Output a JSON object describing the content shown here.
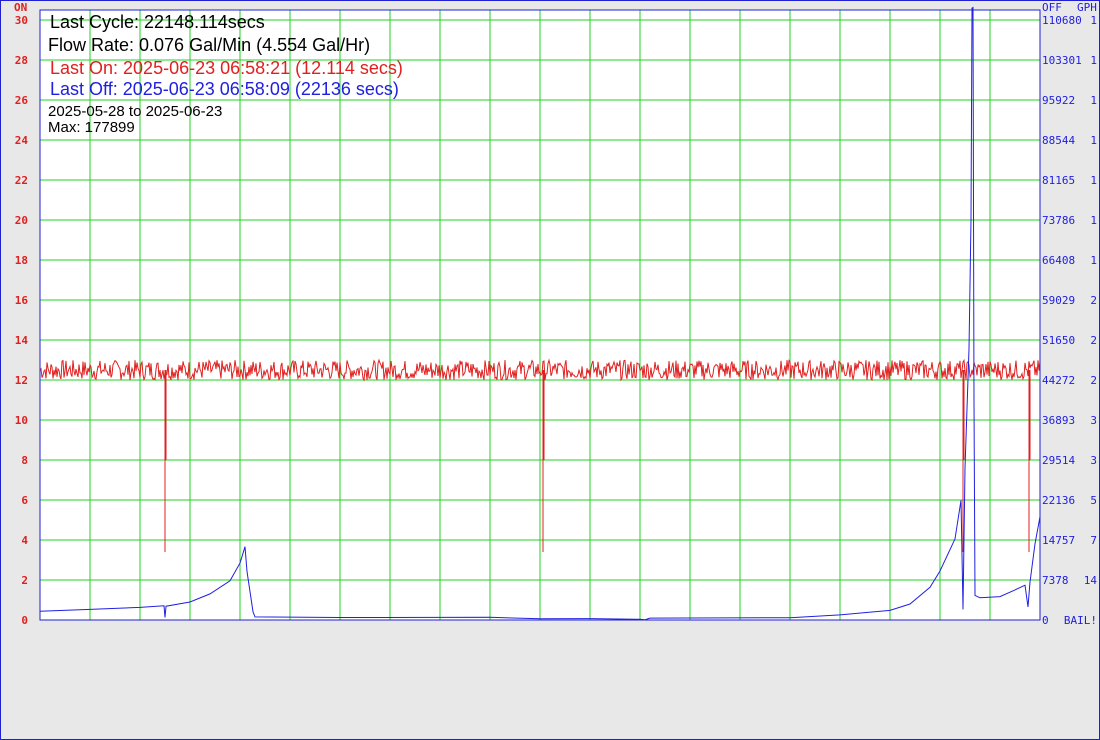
{
  "header": {
    "last_cycle": "Last Cycle: 22148.114secs",
    "flow_rate": "Flow Rate: 0.076 Gal/Min (4.554 Gal/Hr)",
    "last_on": "Last On: 2025-06-23 06:58:21 (12.114 secs)",
    "last_off": "Last Off: 2025-06-23 06:58:09 (22136 secs)",
    "date_range": "2025-05-28 to 2025-06-23",
    "max": "Max: 177899"
  },
  "colors": {
    "on": "#e02020",
    "off": "#2020e0",
    "grid": "#20d020",
    "background": "#ffffff",
    "page": "#e8e8e8"
  },
  "chart_data": {
    "type": "line",
    "left_axis": {
      "title": "ON",
      "ticks": [
        "0",
        "2",
        "4",
        "6",
        "8",
        "10",
        "12",
        "14",
        "16",
        "18",
        "20",
        "22",
        "24",
        "26",
        "28",
        "30"
      ],
      "ylim": [
        0,
        30
      ]
    },
    "right_axis": {
      "title_off": "OFF",
      "title_gph": "GPH",
      "ticks": [
        "0",
        "7378",
        "14757",
        "22136",
        "29514",
        "36893",
        "44272",
        "51650",
        "59029",
        "66408",
        "73786",
        "81165",
        "88544",
        "95922",
        "103301",
        "110680"
      ],
      "gph_ticks": [
        "BAIL!",
        "14",
        "7",
        "5",
        "3",
        "3",
        "2",
        "2",
        "2",
        "1",
        "1",
        "1",
        "1",
        "1",
        "1",
        "1"
      ],
      "ylim": [
        0,
        110680
      ]
    },
    "x_range": [
      "2025-05-28",
      "2025-06-23"
    ],
    "grid": true,
    "series": [
      {
        "name": "Last On",
        "color": "#e02020",
        "baseline": 12.5,
        "noise": 0.5,
        "dips": [
          {
            "x": 0.125,
            "bottom": 3.4,
            "mid": 8
          },
          {
            "x": 0.503,
            "bottom": 3.4,
            "mid": 8
          },
          {
            "x": 0.923,
            "bottom": 3.4,
            "mid": 8
          },
          {
            "x": 0.989,
            "bottom": 3.4,
            "mid": 8
          }
        ]
      },
      {
        "name": "Last Off",
        "color": "#2020e0",
        "points": [
          [
            0,
            1600
          ],
          [
            0.05,
            1900
          ],
          [
            0.1,
            2400
          ],
          [
            0.124,
            2600
          ],
          [
            0.125,
            500
          ],
          [
            0.126,
            2500
          ],
          [
            0.15,
            3400
          ],
          [
            0.17,
            4800
          ],
          [
            0.19,
            7200
          ],
          [
            0.2,
            10500
          ],
          [
            0.205,
            13600
          ],
          [
            0.207,
            9000
          ],
          [
            0.213,
            1500
          ],
          [
            0.215,
            600
          ],
          [
            0.3,
            500
          ],
          [
            0.45,
            400
          ],
          [
            0.5,
            300
          ],
          [
            0.55,
            300
          ],
          [
            0.6,
            200
          ],
          [
            0.605,
            0
          ],
          [
            0.61,
            300
          ],
          [
            0.75,
            400
          ],
          [
            0.8,
            1000
          ],
          [
            0.85,
            1800
          ],
          [
            0.87,
            3000
          ],
          [
            0.89,
            6000
          ],
          [
            0.9,
            9000
          ],
          [
            0.915,
            15000
          ],
          [
            0.921,
            22000
          ],
          [
            0.923,
            2000
          ],
          [
            0.925,
            28000
          ],
          [
            0.929,
            50000
          ],
          [
            0.931,
            73786
          ],
          [
            0.932,
            110680
          ],
          [
            0.933,
            110680
          ],
          [
            0.934,
            40000
          ],
          [
            0.935,
            4500
          ],
          [
            0.94,
            4000
          ],
          [
            0.96,
            4300
          ],
          [
            0.975,
            5500
          ],
          [
            0.985,
            6500
          ],
          [
            0.988,
            2500
          ],
          [
            0.99,
            7000
          ],
          [
            0.995,
            14000
          ],
          [
            1.0,
            19000
          ]
        ]
      }
    ]
  }
}
